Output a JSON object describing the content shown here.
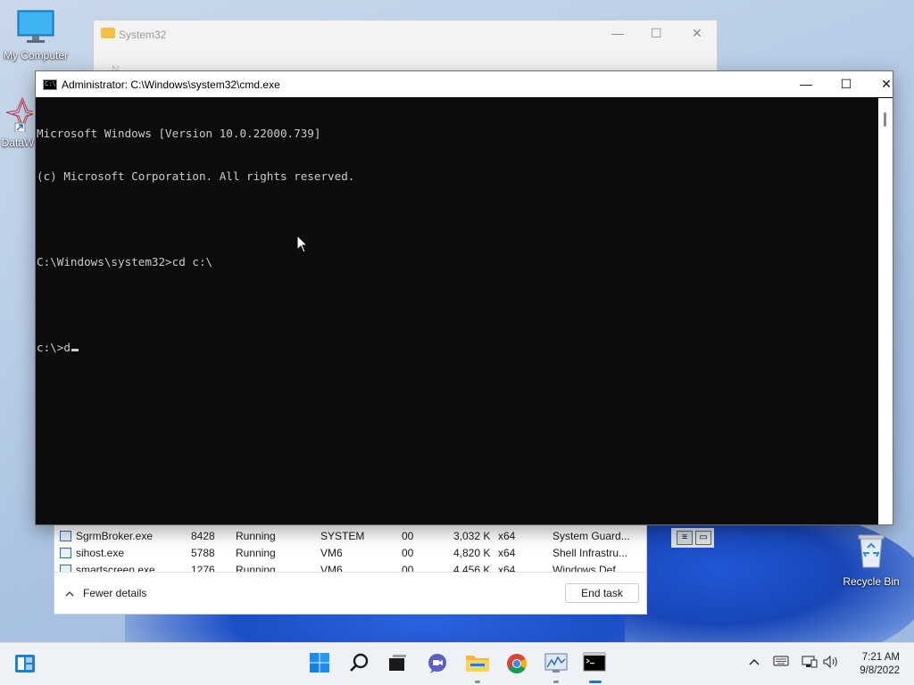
{
  "desktop": {
    "icons": [
      {
        "name": "My Computer"
      },
      {
        "name": "DataW"
      },
      {
        "name": "Recycle Bin"
      }
    ]
  },
  "explorer": {
    "title": "System32",
    "toolbar_hint": "N",
    "minimize": "—",
    "maximize": "☐",
    "close": "✕"
  },
  "cmd": {
    "title": "Administrator: C:\\Windows\\system32\\cmd.exe",
    "minimize": "—",
    "maximize": "☐",
    "close": "✕",
    "lines": [
      "Microsoft Windows [Version 10.0.22000.739]",
      "(c) Microsoft Corporation. All rights reserved.",
      "",
      "C:\\Windows\\system32>cd c:\\",
      "",
      "c:\\>d"
    ]
  },
  "taskmgr": {
    "rows": [
      {
        "name": "SgrmBroker.exe",
        "pid": "8428",
        "status": "Running",
        "user": "SYSTEM",
        "cpu": "00",
        "mem": "3,032 K",
        "arch": "x64",
        "desc": "System Guard..."
      },
      {
        "name": "sihost.exe",
        "pid": "5788",
        "status": "Running",
        "user": "VM6",
        "cpu": "00",
        "mem": "4,820 K",
        "arch": "x64",
        "desc": "Shell Infrastru..."
      },
      {
        "name": "smartscreen.exe",
        "pid": "1276",
        "status": "Running",
        "user": "VM6",
        "cpu": "00",
        "mem": "4,456 K",
        "arch": "x64",
        "desc": "Windows Def..."
      }
    ],
    "fewer_details": "Fewer details",
    "end_task": "End task"
  },
  "taskbar": {
    "time": "7:21 AM",
    "date": "9/8/2022"
  }
}
